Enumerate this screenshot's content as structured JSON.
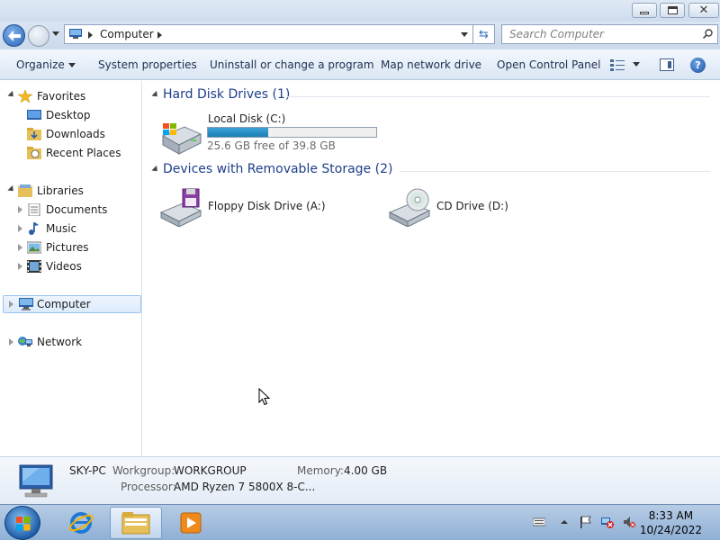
{
  "window": {
    "title_buttons": [
      "minimize",
      "maximize",
      "close"
    ]
  },
  "address": {
    "crumb": "Computer",
    "search_placeholder": "Search Computer"
  },
  "toolbar": {
    "organize": "Organize",
    "system_properties": "System properties",
    "uninstall": "Uninstall or change a program",
    "map_drive": "Map network drive",
    "open_cp": "Open Control Panel"
  },
  "nav": {
    "favorites": "Favorites",
    "desktop": "Desktop",
    "downloads": "Downloads",
    "recent": "Recent Places",
    "libraries": "Libraries",
    "documents": "Documents",
    "music": "Music",
    "pictures": "Pictures",
    "videos": "Videos",
    "computer": "Computer",
    "network": "Network"
  },
  "groups": {
    "hdd": "Hard Disk Drives (1)",
    "removable": "Devices with Removable Storage (2)"
  },
  "drives": {
    "local": {
      "name": "Local Disk (C:)",
      "free_text": "25.6 GB free of 39.8 GB",
      "used_fraction": 0.357
    },
    "floppy": {
      "name": "Floppy Disk Drive (A:)"
    },
    "cd": {
      "name": "CD Drive (D:)"
    }
  },
  "details": {
    "pc_name": "SKY-PC",
    "workgroup_label": "Workgroup:",
    "workgroup": "WORKGROUP",
    "memory_label": "Memory:",
    "memory": "4.00 GB",
    "processor_label": "Processor:",
    "processor": "AMD Ryzen 7 5800X 8-C..."
  },
  "taskbar": {
    "time": "8:33 AM",
    "date": "10/24/2022"
  },
  "colors": {
    "accent": "#1e3e8a",
    "capacity_fill": "#2a93c9"
  }
}
